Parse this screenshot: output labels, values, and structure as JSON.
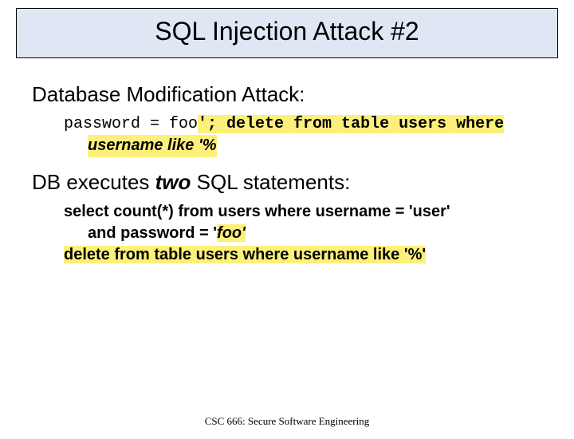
{
  "title": "SQL Injection Attack #2",
  "section1": {
    "heading": "Database Modification Attack:",
    "code_prefix": "password =  foo",
    "code_hl1": "'; delete from table users where",
    "code_hl2": "username like '%"
  },
  "section2": {
    "heading_pre": "DB executes ",
    "heading_em": "two",
    "heading_post": " SQL statements:",
    "l1_a": "select count(*) from users where username = 'user'",
    "l2_a": "and password = '",
    "l2_b": "foo'",
    "l3_a": "delete from table users where username like '%'"
  },
  "footer": "CSC 666: Secure Software Engineering"
}
